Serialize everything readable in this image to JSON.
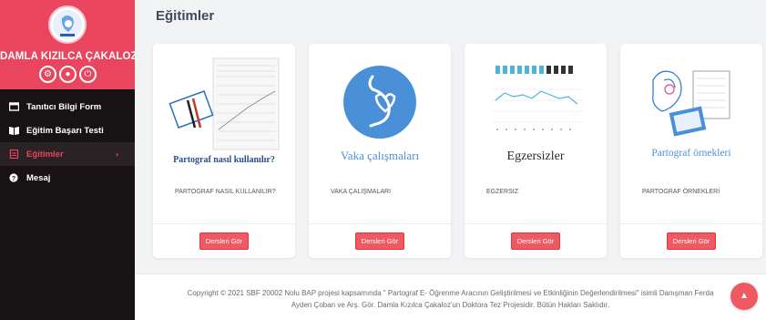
{
  "sidebar": {
    "user_name": "DAMLA KIZILCA ÇAKALOZ",
    "menu": [
      {
        "label": "Tanıtıcı Bilgi Form",
        "icon": "id-card-icon"
      },
      {
        "label": "Eğitim Başarı Testi",
        "icon": "book-icon"
      },
      {
        "label": "Eğitimler",
        "icon": "document-icon",
        "active": true
      },
      {
        "label": "Mesaj",
        "icon": "question-circle-icon"
      }
    ],
    "avatar_icon_names": [
      "settings-icon",
      "chat-icon",
      "power-icon"
    ]
  },
  "header": {
    "title": "Eğitimler"
  },
  "cards": [
    {
      "image_caption": "Partograf nasıl kullanılır?",
      "description": "PARTOGRAF NASIL KULLANILIR?",
      "button": "Dersleri Gör"
    },
    {
      "image_caption": "Vaka çalışmaları",
      "description": "VAKA ÇALIŞMALARI",
      "button": "Dersleri Gör"
    },
    {
      "image_caption": "Egzersizler",
      "description": "EGZERSIZ",
      "button": "Dersleri Gör"
    },
    {
      "image_caption": "Partograf örnekleri",
      "description": "PARTOGRAF ÖRNEKLERİ",
      "button": "Dersleri Gör"
    }
  ],
  "footer": {
    "line1": "Copyright © 2021 SBF 20002 Nolu BAP projesi kapsamında \" Partograf E- Öğrenme Aracının Geliştirilmesi ve Etkinliğinin Değerlendirilmesi\" isimli Danışman Ferda",
    "line2": "Ayden Çoban ve Arş. Gör. Damla Kızılca Çakaloz'un Doktora Tez Projesidir. Bütün Hakları Saklıdır."
  },
  "colors": {
    "accent": "#e9455e",
    "sidebar_bg": "#171214",
    "button": "#ef5a62",
    "blue": "#4a90d9"
  }
}
